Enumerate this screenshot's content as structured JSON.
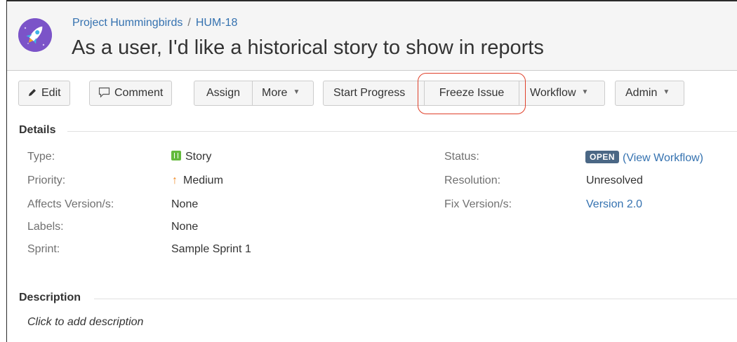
{
  "breadcrumb": {
    "project": "Project Hummingbirds",
    "separator": "/",
    "issue_key": "HUM-18"
  },
  "title": "As a user, I'd like a historical story to show in reports",
  "toolbar": {
    "edit": "Edit",
    "comment": "Comment",
    "assign": "Assign",
    "more": "More",
    "start_progress": "Start Progress",
    "freeze_issue": "Freeze Issue",
    "workflow": "Workflow",
    "admin": "Admin"
  },
  "details": {
    "heading": "Details",
    "left": [
      {
        "label": "Type:",
        "value": "Story",
        "icon": "story-icon"
      },
      {
        "label": "Priority:",
        "value": "Medium",
        "icon": "priority-up-arrow-icon"
      },
      {
        "label": "Affects Version/s:",
        "value": "None"
      },
      {
        "label": "Labels:",
        "value": "None"
      },
      {
        "label": "Sprint:",
        "value": "Sample Sprint 1"
      }
    ],
    "right": [
      {
        "label": "Status:",
        "badge": "OPEN",
        "value": "(View Workflow)"
      },
      {
        "label": "Resolution:",
        "value": "Unresolved"
      },
      {
        "label": "Fix Version/s:",
        "value": "Version 2.0"
      }
    ]
  },
  "description": {
    "heading": "Description",
    "placeholder": "Click to add description"
  },
  "colors": {
    "link": "#3572b0",
    "status_badge": "#4a6785",
    "story_icon": "#63ba3c",
    "priority_arrow": "#f08a24",
    "highlight": "#e0402a",
    "avatar": "#7b53c8"
  }
}
